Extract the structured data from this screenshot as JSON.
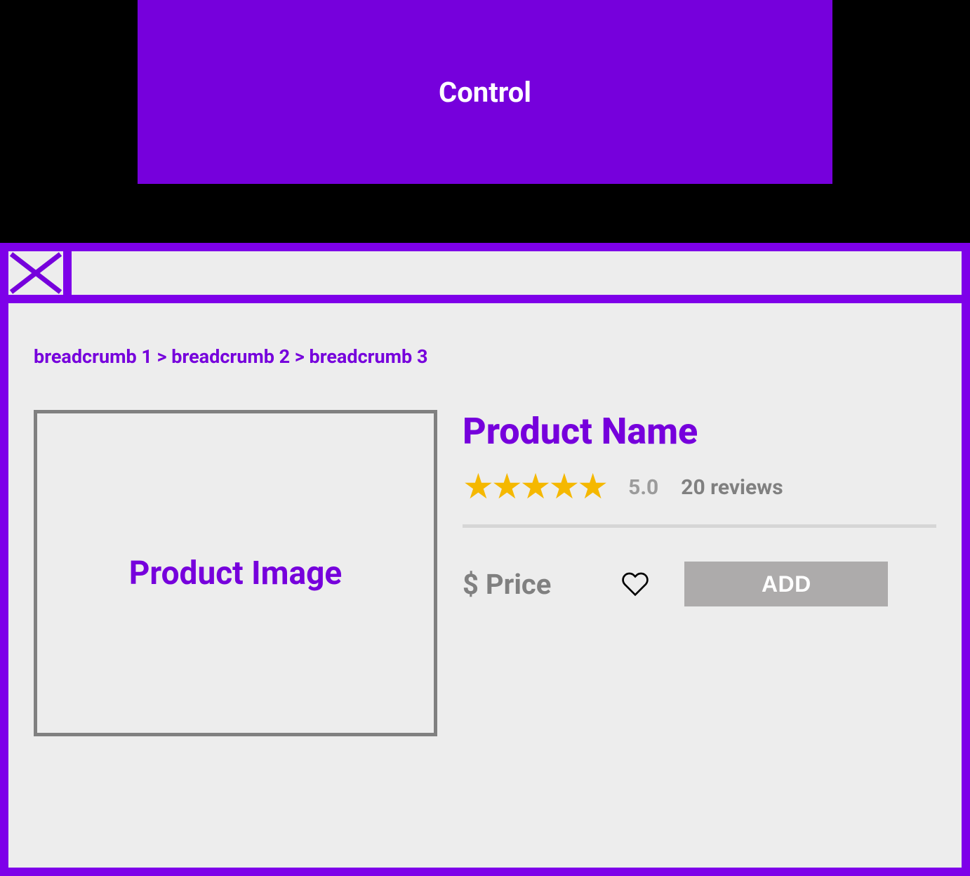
{
  "header": {
    "control_label": "Control"
  },
  "toolbar": {
    "url_value": "",
    "close_icon_name": "close-icon"
  },
  "breadcrumb": {
    "items": [
      "breadcrumb 1",
      "breadcrumb 2",
      "breadcrumb 3"
    ],
    "separator": " > ",
    "full_text": "breadcrumb 1 > breadcrumb 2 > breadcrumb 3"
  },
  "product": {
    "image_placeholder_label": "Product Image",
    "name": "Product Name",
    "rating": {
      "stars": 5,
      "stars_display": "★★★★★",
      "value": "5.0",
      "review_count_text": "20 reviews"
    },
    "price_label": "$ Price",
    "actions": {
      "favorite_icon_name": "heart-icon",
      "add_button_label": "ADD"
    }
  },
  "colors": {
    "brand_purple": "#7600dc",
    "frame_purple": "#7e00e9",
    "background_light": "#ededed",
    "star_yellow": "#f5b800",
    "muted_gray": "#808080",
    "button_gray": "#adabab"
  }
}
